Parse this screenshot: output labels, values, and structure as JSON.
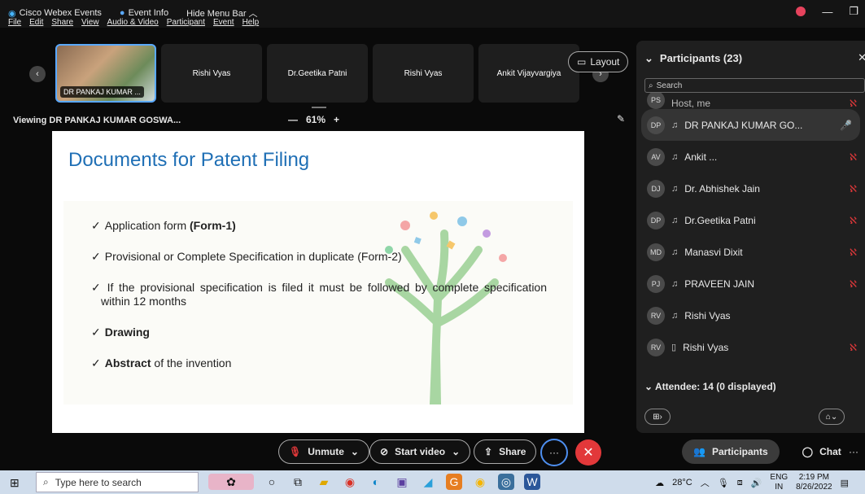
{
  "titlebar": {
    "app_name": "Cisco Webex Events",
    "event_info": "Event Info",
    "hide_menu": "Hide Menu Bar ︿"
  },
  "menu": [
    "File",
    "Edit",
    "Share",
    "View",
    "Audio & Video",
    "Participant",
    "Event",
    "Help"
  ],
  "thumbnails": {
    "video_name": "DR PANKAJ KUMAR ...",
    "tiles": [
      "Rishi Vyas",
      "Dr.Geetika Patni",
      "Rishi Vyas",
      "Ankit Vijayvargiya"
    ]
  },
  "layout_label": "Layout",
  "viewing_label": "Viewing DR PANKAJ KUMAR GOSWA...",
  "zoom": {
    "minus": "—",
    "value": "61%",
    "plus": "+"
  },
  "slide": {
    "title": "Documents for Patent Filing",
    "bullets": [
      {
        "plain": "Application form ",
        "bold": "(Form-1)",
        "after": ""
      },
      {
        "plain": "Provisional or Complete Specification in duplicate (Form-2)",
        "bold": "",
        "after": ""
      },
      {
        "plain": "If the provisional specification is filed it must be followed by complete specification within 12 months",
        "bold": "",
        "after": ""
      },
      {
        "plain": "",
        "bold": "Drawing",
        "after": ""
      },
      {
        "plain": "",
        "bold": "Abstract",
        "after": " of the invention"
      }
    ],
    "check": "✓"
  },
  "controls": {
    "unmute": "Unmute",
    "start_video": "Start video",
    "share": "Share",
    "more": "···"
  },
  "panel": {
    "title": "Participants (23)",
    "search_placeholder": "Search",
    "host_row": "Host, me",
    "participants": [
      {
        "initials": "DP",
        "name": "DR PANKAJ KUMAR GO...",
        "status": "unmuted"
      },
      {
        "initials": "AV",
        "name": "Ankit ...",
        "status": "muted"
      },
      {
        "initials": "DJ",
        "name": "Dr. Abhishek Jain",
        "status": "muted"
      },
      {
        "initials": "DP",
        "name": "Dr.Geetika Patni",
        "status": "muted"
      },
      {
        "initials": "MD",
        "name": "Manasvi Dixit",
        "status": "muted"
      },
      {
        "initials": "PJ",
        "name": "PRAVEEN JAIN",
        "status": "muted"
      },
      {
        "initials": "RV",
        "name": "Rishi Vyas",
        "status": "none"
      },
      {
        "initials": "RV",
        "name": "Rishi Vyas",
        "status": "muted"
      }
    ],
    "attendee": "Attendee: 14 (0 displayed)",
    "host_initials": "PS"
  },
  "tabs": {
    "participants": "Participants",
    "chat": "Chat"
  },
  "taskbar": {
    "search_placeholder": "Type here to search",
    "weather": "28°C",
    "lang": "ENG",
    "region": "IN",
    "time": "2:19 PM",
    "date": "8/26/2022"
  },
  "colors": {
    "accent": "#1f6fb5",
    "leave": "#e2383a",
    "active_ring": "#4e8ff0"
  }
}
